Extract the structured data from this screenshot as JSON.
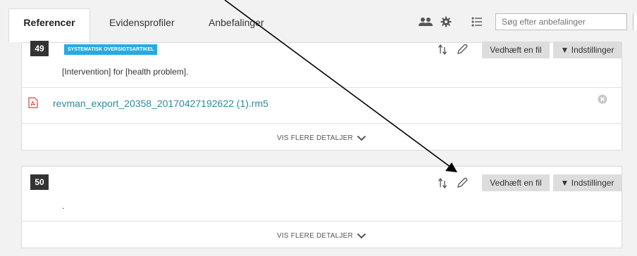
{
  "tabs": {
    "referencer": "Referencer",
    "evidensprofiler": "Evidensprofiler",
    "anbefalinger": "Anbefalinger"
  },
  "search": {
    "placeholder": "Søg efter anbefalinger"
  },
  "cards": [
    {
      "number": "49",
      "badge": "SYSTEMATISK OVERSIGTSARTIKEL",
      "text": "[Intervention] for [health problem].",
      "attach_label": "Vedhæft en fil",
      "settings_label": "▼ Indstillinger",
      "file_name": "revman_export_20358_20170427192622 (1).rm5",
      "details_label": "VIS FLERE DETALJER"
    },
    {
      "number": "50",
      "text": ".",
      "attach_label": "Vedhæft en fil",
      "settings_label": "▼ Indstillinger",
      "details_label": "VIS FLERE DETALJER"
    }
  ],
  "icons": {
    "users": "users-icon",
    "gear": "gear-icon",
    "list": "list-icon",
    "sort": "sort-icon",
    "pencil": "pencil-icon",
    "pdf": "pdf-icon",
    "close": "close-circle-icon",
    "chevron": "chevron-down-icon"
  }
}
